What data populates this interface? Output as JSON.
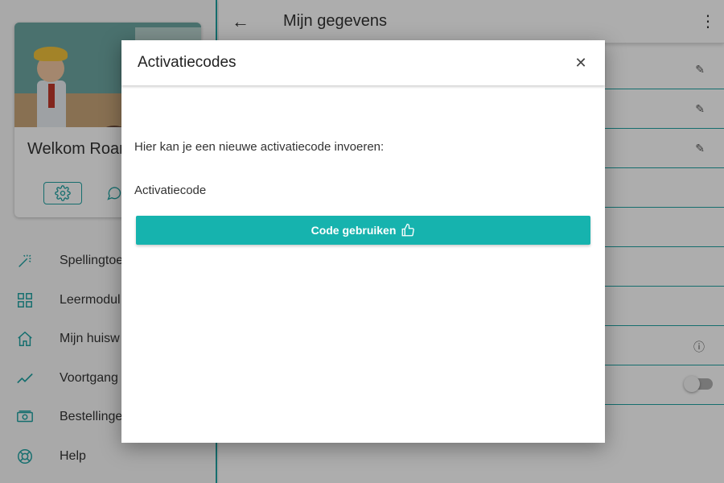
{
  "sidebar": {
    "welcome": "Welkom Roar",
    "items": [
      {
        "label": "Spellingtoe",
        "icon": "magic-wand-icon"
      },
      {
        "label": "Leermodul",
        "icon": "grid-icon"
      },
      {
        "label": "Mijn huisw",
        "icon": "home-icon"
      },
      {
        "label": "Voortgang",
        "icon": "trend-line-icon"
      },
      {
        "label": "Bestellinge",
        "icon": "money-icon"
      },
      {
        "label": "Help",
        "icon": "lifebuoy-icon"
      }
    ]
  },
  "appbar": {
    "title": "Mijn gegevens"
  },
  "modal": {
    "title": "Activatiecodes",
    "description": "Hier kan je een nieuwe activatiecode invoeren:",
    "field_label": "Activatiecode",
    "submit_label": "Code gebruiken"
  },
  "colors": {
    "accent": "#1fa3a3",
    "button": "#16b3ae"
  }
}
